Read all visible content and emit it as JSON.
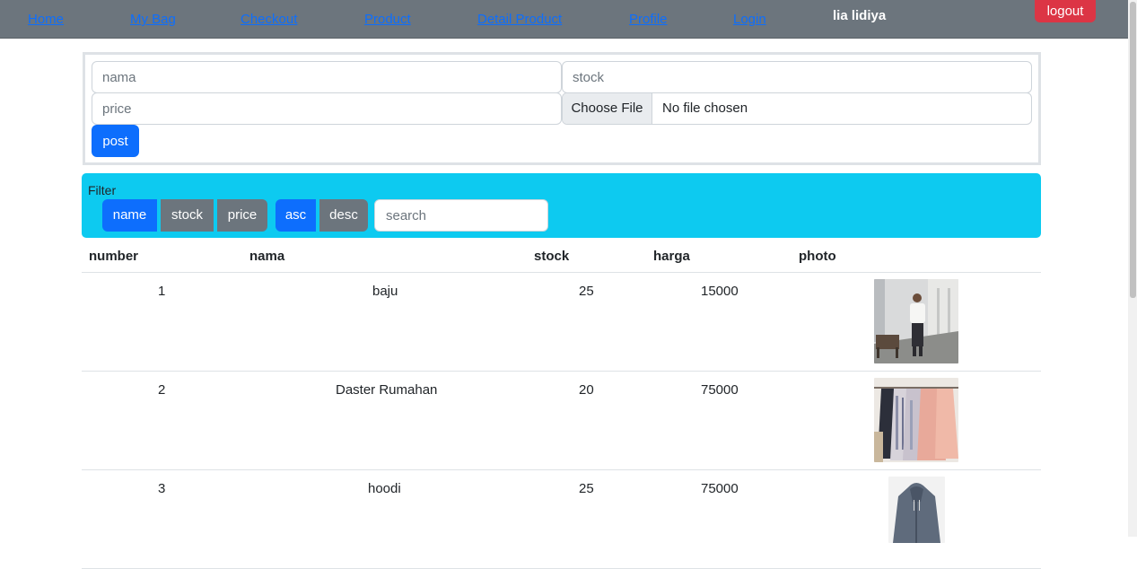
{
  "nav": {
    "links": [
      "Home",
      "My Bag",
      "Checkout",
      "Product",
      "Detail Product",
      "Profile",
      "Login"
    ],
    "username": "lia lidiya",
    "logout_label": "logout"
  },
  "form": {
    "nama_placeholder": "nama",
    "stock_placeholder": "stock",
    "price_placeholder": "price",
    "choose_file_label": "Choose File",
    "no_file_text": "No file chosen",
    "post_label": "post"
  },
  "filter": {
    "label": "Filter",
    "sort_fields": [
      "name",
      "stock",
      "price"
    ],
    "sort_orders": [
      "asc",
      "desc"
    ],
    "search_placeholder": "search"
  },
  "table": {
    "columns": [
      "number",
      "nama",
      "stock",
      "harga",
      "photo"
    ],
    "rows": [
      {
        "number": "1",
        "nama": "baju",
        "stock": "25",
        "harga": "15000",
        "photo": "photo-man-white-shirt"
      },
      {
        "number": "2",
        "nama": "Daster Rumahan",
        "stock": "20",
        "harga": "75000",
        "photo": "photo-dresses-on-rack"
      },
      {
        "number": "3",
        "nama": "hoodi",
        "stock": "25",
        "harga": "75000",
        "photo": "photo-gray-hoodie"
      }
    ]
  },
  "colors": {
    "navbar": "#6c757d",
    "primary": "#0d6efd",
    "secondary": "#6c757d",
    "danger": "#dc3545",
    "info": "#0dcaf0"
  }
}
